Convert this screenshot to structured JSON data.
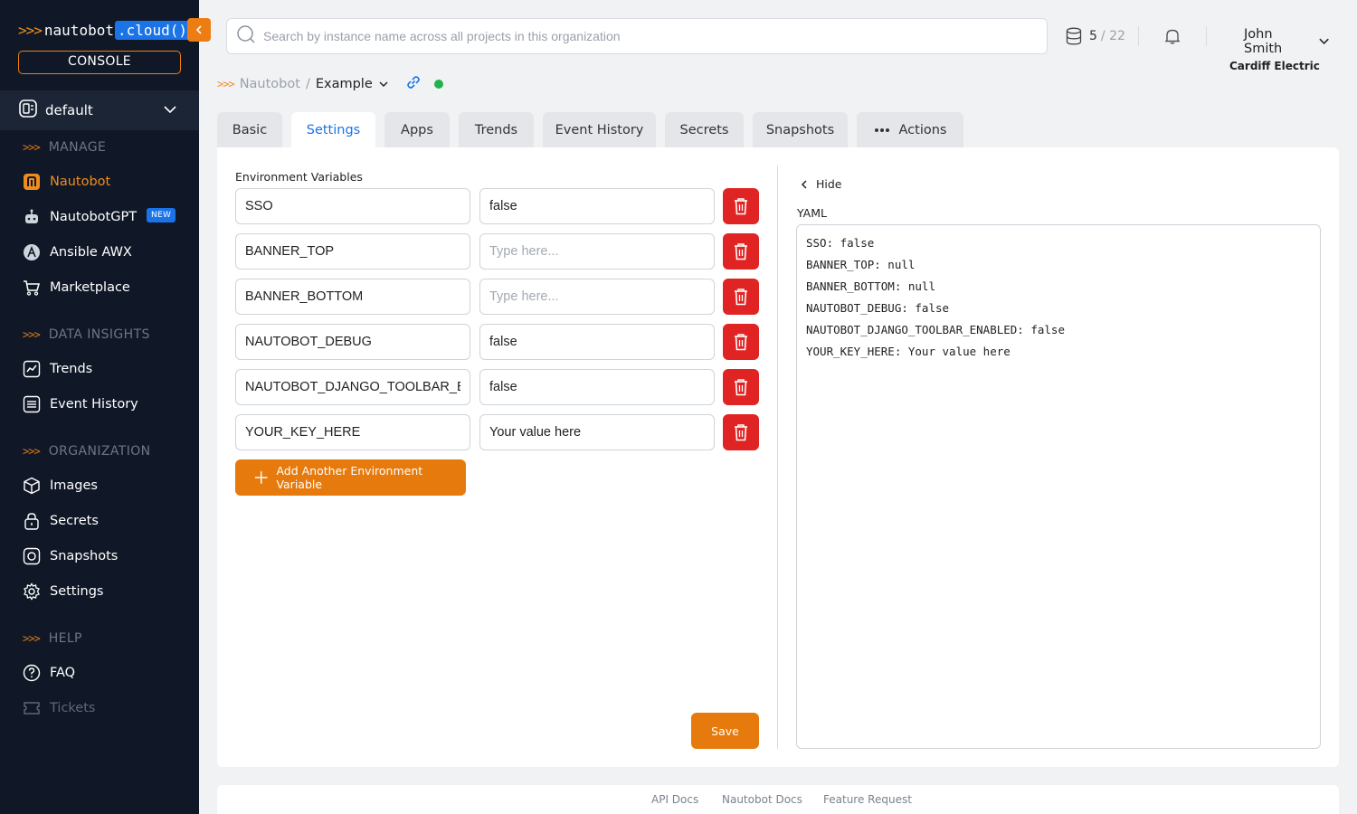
{
  "brand": {
    "prefix": ">>>",
    "word": "nautobot",
    "cloud": ".cloud()",
    "accent": "#ed7d12",
    "blue": "#1a74e8"
  },
  "sidebar": {
    "console_label": "CONSOLE",
    "org": "default",
    "sections": {
      "manage": "MANAGE",
      "data_insights": "DATA INSIGHTS",
      "organization": "ORGANIZATION",
      "help": "HELP"
    },
    "items": {
      "nautobot": "Nautobot",
      "nautobotgpt": "NautobotGPT",
      "new_badge": "NEW",
      "ansible": "Ansible AWX",
      "marketplace": "Marketplace",
      "trends": "Trends",
      "event_history": "Event History",
      "images": "Images",
      "secrets": "Secrets",
      "snapshots": "Snapshots",
      "settings": "Settings",
      "faq": "FAQ",
      "tickets": "Tickets"
    }
  },
  "search": {
    "placeholder": "Search by instance name across all projects in this organization"
  },
  "usage": {
    "used": "5",
    "total": "/ 22"
  },
  "user": {
    "name": "John Smith",
    "company": "Cardiff Electric"
  },
  "breadcrumb": {
    "root": "Nautobot",
    "sep": "/",
    "instance": "Example",
    "status": "online"
  },
  "tabs": {
    "basic": "Basic",
    "settings": "Settings",
    "apps": "Apps",
    "trends": "Trends",
    "event_history": "Event History",
    "secrets": "Secrets",
    "snapshots": "Snapshots",
    "actions": "Actions"
  },
  "env": {
    "label": "Environment Variables",
    "placeholder": "Type here...",
    "rows": [
      {
        "key": "SSO",
        "value": "false"
      },
      {
        "key": "BANNER_TOP",
        "value": ""
      },
      {
        "key": "BANNER_BOTTOM",
        "value": ""
      },
      {
        "key": "NAUTOBOT_DEBUG",
        "value": "false"
      },
      {
        "key": "NAUTOBOT_DJANGO_TOOLBAR_ENABLED",
        "value": "false"
      },
      {
        "key": "YOUR_KEY_HERE",
        "value": "Your value here"
      }
    ],
    "add_label": "Add Another Environment Variable",
    "save_label": "Save"
  },
  "yaml": {
    "hide_label": "Hide",
    "label": "YAML",
    "lines": [
      "SSO: false",
      "BANNER_TOP: null",
      "BANNER_BOTTOM: null",
      "NAUTOBOT_DEBUG: false",
      "NAUTOBOT_DJANGO_TOOLBAR_ENABLED: false",
      "YOUR_KEY_HERE: Your value here"
    ]
  },
  "footer": {
    "api_docs": "API Docs",
    "nautobot_docs": "Nautobot Docs",
    "feature_request": "Feature Request"
  }
}
